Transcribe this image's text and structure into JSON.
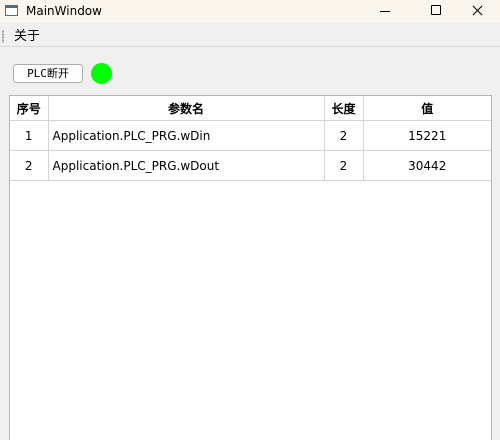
{
  "window": {
    "title": "MainWindow",
    "icon": "window-app-icon",
    "controls": [
      "minimize-icon",
      "maximize-icon",
      "close-icon"
    ]
  },
  "menu": {
    "items": [
      {
        "label": "关于"
      }
    ]
  },
  "toolbar": {
    "plc_button_label": "PLC断开",
    "status_color": "#00ff00"
  },
  "table": {
    "columns": [
      "序号",
      "参数名",
      "长度",
      "值"
    ],
    "rows": [
      {
        "index": "1",
        "name": "Application.PLC_PRG.wDin",
        "length": "2",
        "value": "15221"
      },
      {
        "index": "2",
        "name": "Application.PLC_PRG.wDout",
        "length": "2",
        "value": "30442"
      }
    ]
  }
}
